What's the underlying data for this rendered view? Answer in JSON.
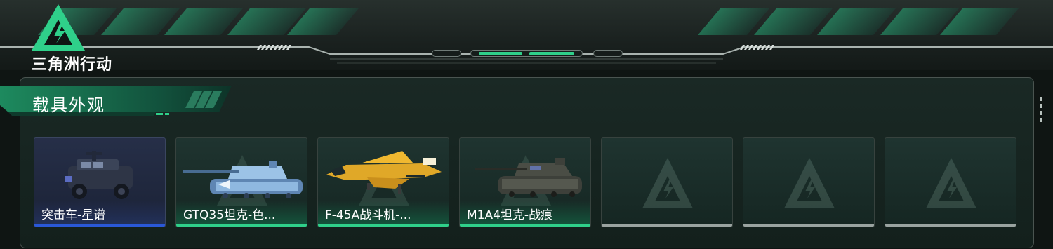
{
  "brand": {
    "title": "三角洲行动",
    "accent": "#2fd08a"
  },
  "section": {
    "title": "载具外观"
  },
  "cards": [
    {
      "label": "突击车-星谱",
      "icon": "assault-vehicle",
      "state": "selected",
      "underline_color": "#2a58d8"
    },
    {
      "label": "GTQ35坦克-色...",
      "icon": "tank",
      "state": "owned",
      "underline_color": "#2fd08a"
    },
    {
      "label": "F-45A战斗机-...",
      "icon": "fighter-jet",
      "state": "owned",
      "underline_color": "#2fd08a"
    },
    {
      "label": "M1A4坦克-战痕",
      "icon": "tank",
      "state": "owned",
      "underline_color": "#2fd08a"
    },
    {
      "label": "",
      "icon": "delta-logo",
      "state": "empty"
    },
    {
      "label": "",
      "icon": "delta-logo",
      "state": "empty"
    },
    {
      "label": "",
      "icon": "delta-logo",
      "state": "empty"
    }
  ]
}
